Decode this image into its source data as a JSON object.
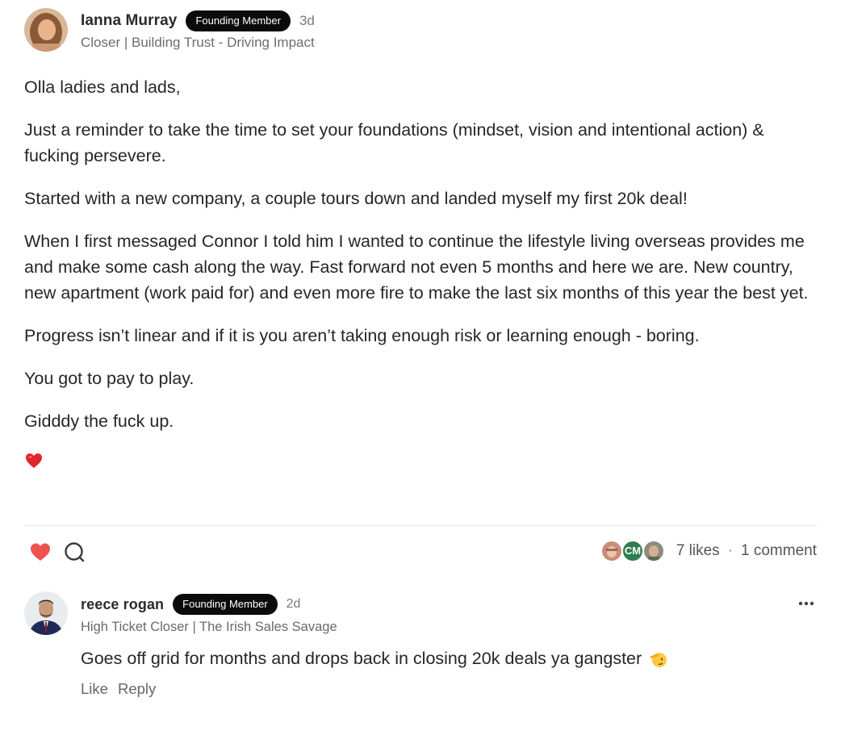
{
  "post": {
    "author": {
      "name": "Ianna Murray",
      "badge": "Founding Member",
      "time": "3d",
      "bio": "Closer | Building Trust - Driving Impact"
    },
    "paragraphs": [
      "Olla ladies and lads,",
      "Just a reminder to take the time to set your foundations (mindset, vision and intentional action) & fucking persevere.",
      "Started with a new company, a couple tours down and landed myself my first 20k deal!",
      "When I first messaged Connor I told him I wanted to continue the lifestyle living overseas provides me and make some cash along the way. Fast forward not even 5 months and here we are. New country, new apartment (work paid for) and even more fire to make the last six months of this year the best yet.",
      "Progress isn’t linear and if it is you aren’t taking enough risk or learning enough - boring.",
      "You got to pay to play.",
      "Gidddy the fuck up."
    ],
    "end_emoji": "heart-emoji",
    "likers": [
      "liker-avatar-1",
      "CM",
      "liker-avatar-3"
    ],
    "likes_text": "7 likes",
    "separator": "·",
    "comments_text": "1 comment",
    "colors": {
      "like_heart": "#ef5350",
      "badge_bg": "#0b0b0b",
      "cm_avatar": "#2f7d4d"
    }
  },
  "comment": {
    "author": {
      "name": "reece rogan",
      "badge": "Founding Member",
      "time": "2d",
      "bio": "High Ticket Closer | The Irish Sales Savage"
    },
    "text": "Goes off grid for months and drops back in closing 20k deals ya gangster",
    "emoji": "salute-emoji",
    "like_label": "Like",
    "reply_label": "Reply"
  }
}
